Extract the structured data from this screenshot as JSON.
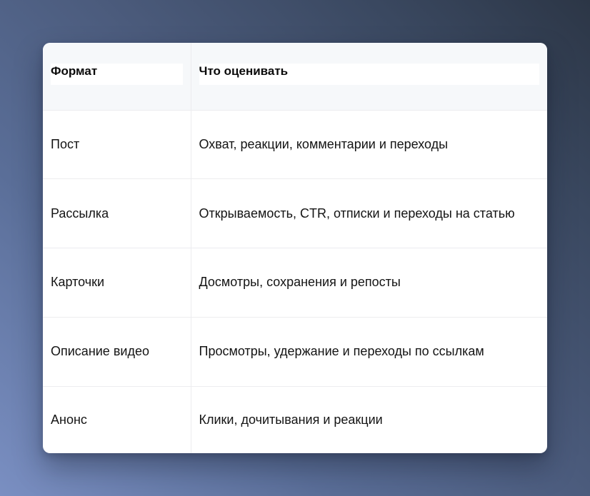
{
  "table": {
    "headers": [
      "Формат",
      "Что оценивать"
    ],
    "rows": [
      [
        "Пост",
        "Охват, реакции, комментарии и переходы"
      ],
      [
        "Рассылка",
        "Открываемость, CTR, отписки и переходы на статью"
      ],
      [
        "Карточки",
        "Досмотры, сохранения и репосты"
      ],
      [
        "Описание видео",
        "Просмотры, удержание и переходы по ссылкам"
      ],
      [
        "Анонс",
        "Клики, дочитывания и реакции"
      ]
    ]
  }
}
